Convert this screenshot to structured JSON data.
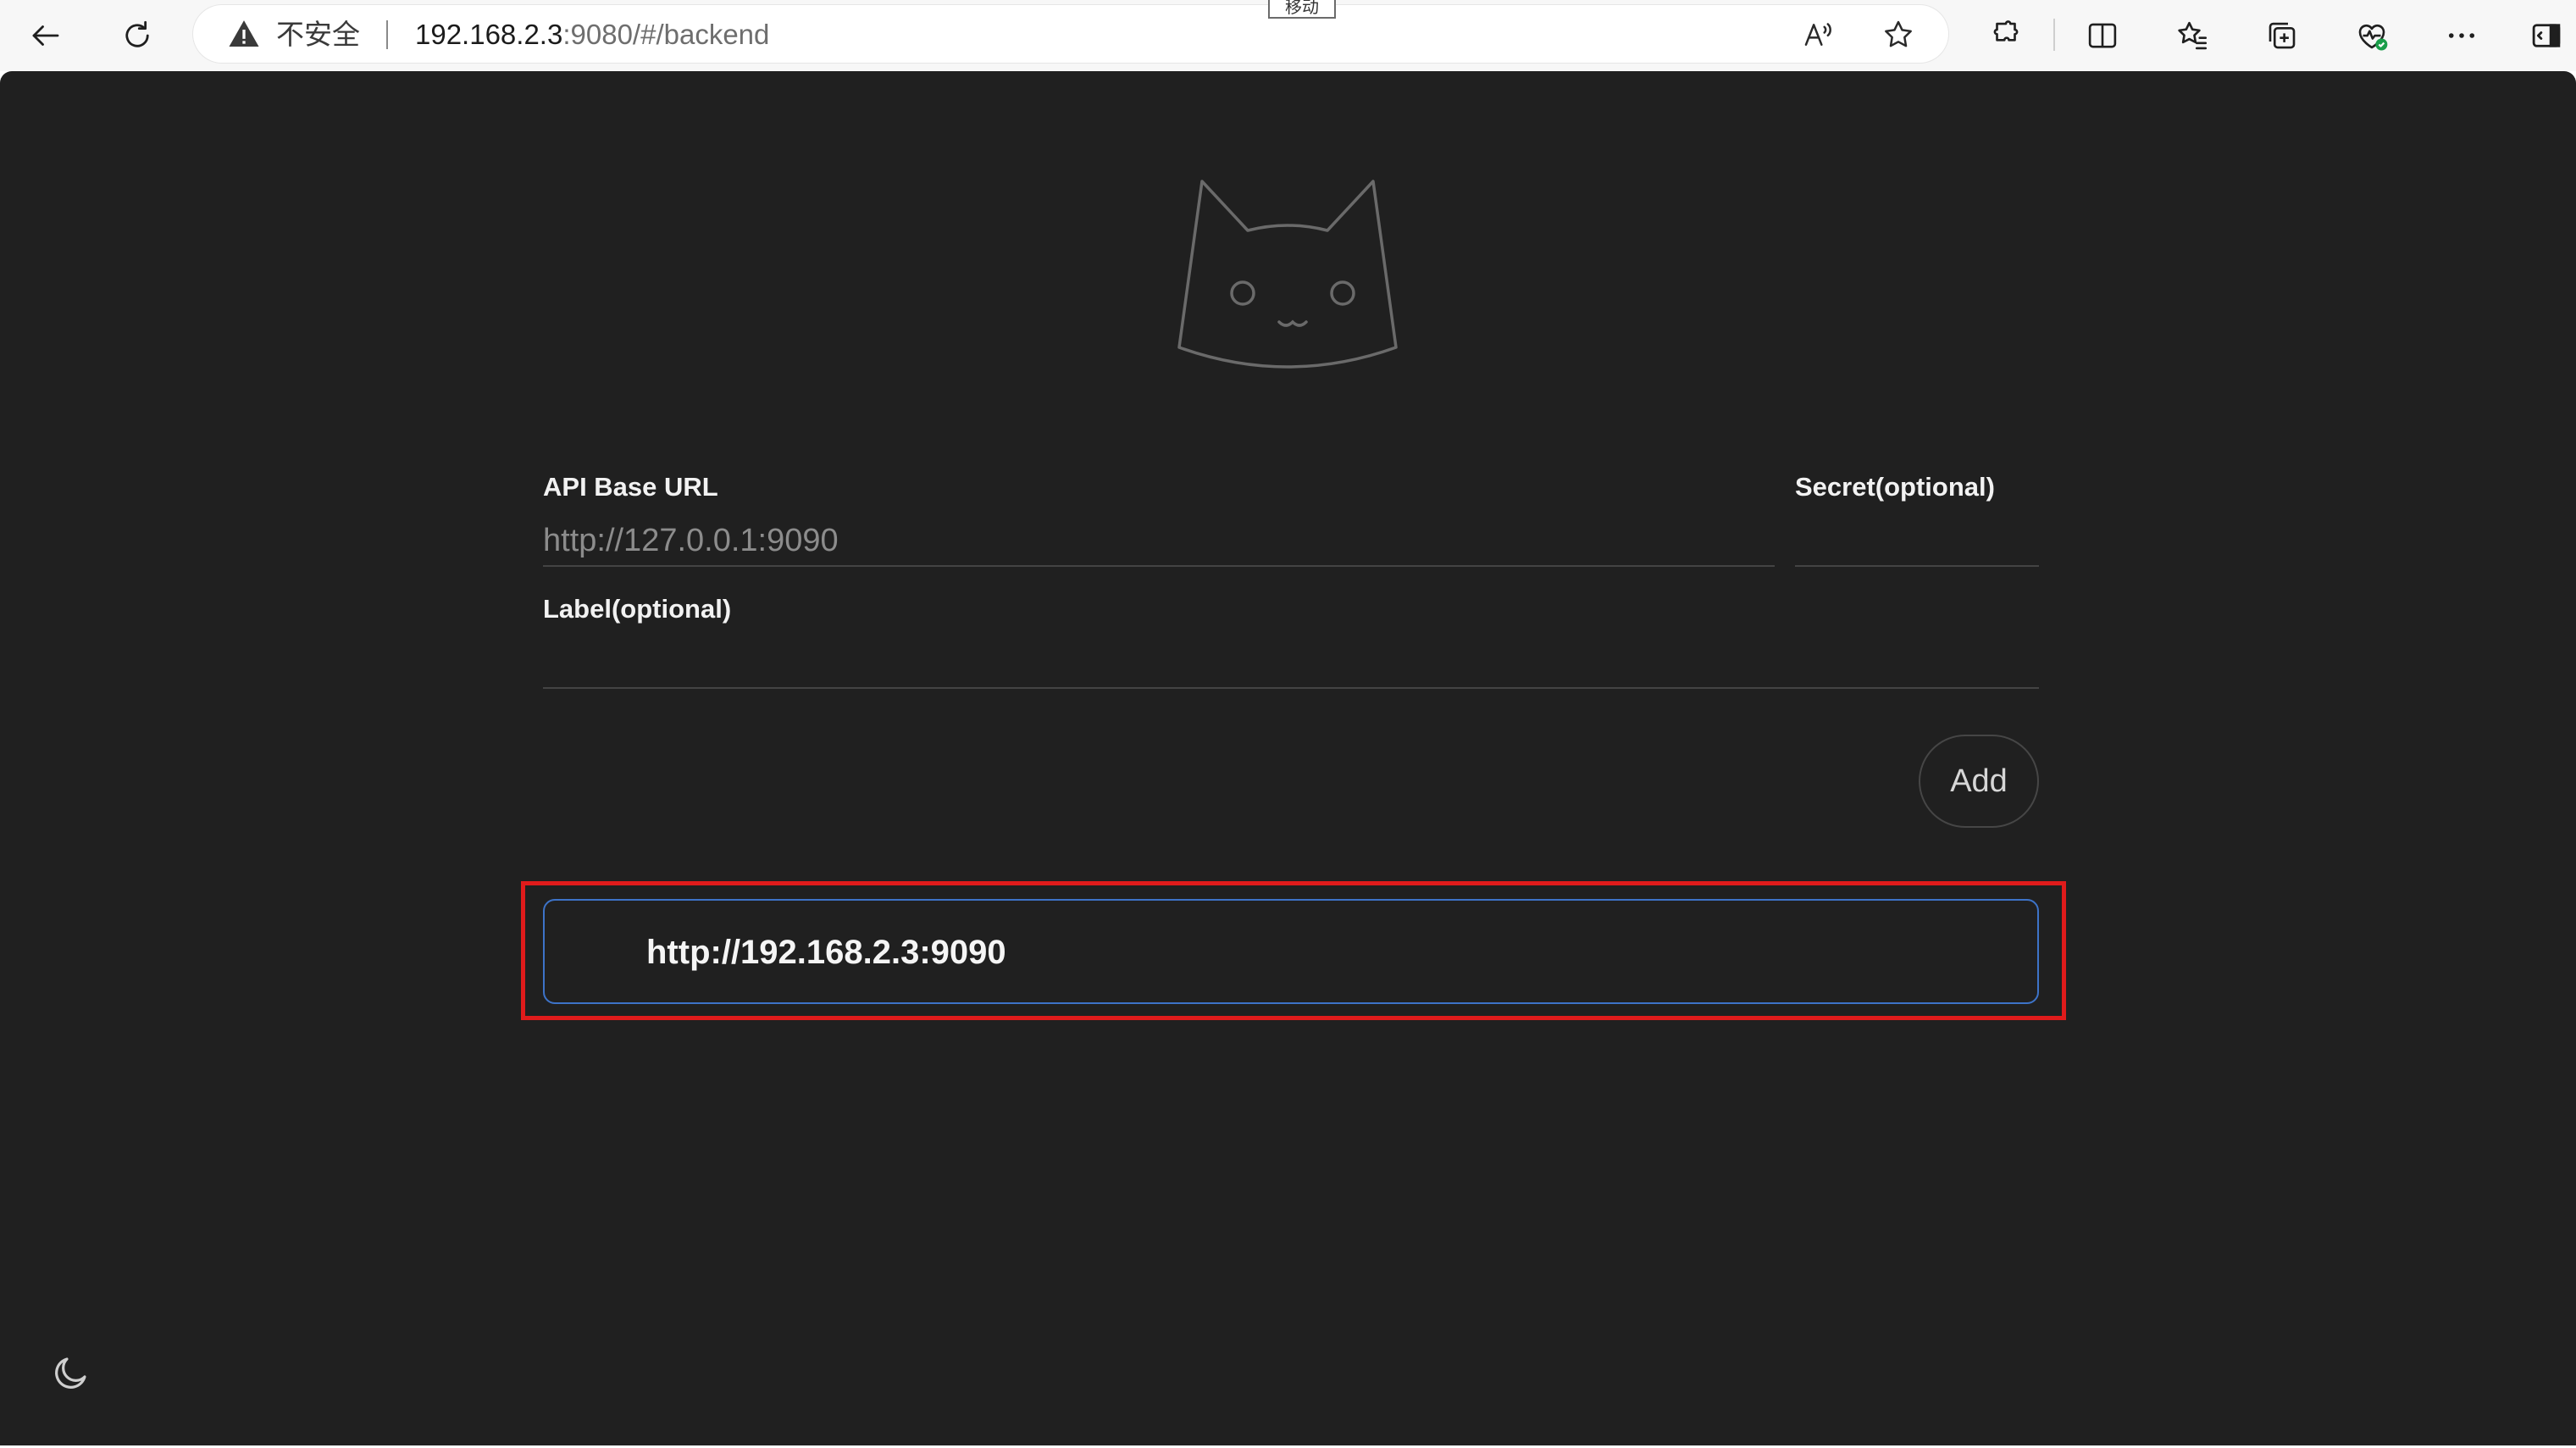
{
  "browser": {
    "tooltip": "移动",
    "security_label": "不安全",
    "url_host": "192.168.2.3",
    "url_rest": ":9080/#/backend",
    "icons": [
      "back-icon",
      "refresh-icon",
      "warning-icon",
      "read-aloud-icon",
      "favorite-star-icon",
      "extensions-icon",
      "split-screen-icon",
      "favorites-icon",
      "collections-icon",
      "browser-essentials-icon",
      "more-icon",
      "sidebar-icon"
    ]
  },
  "form": {
    "api_base_url_label": "API Base URL",
    "api_base_url_placeholder": "http://127.0.0.1:9090",
    "secret_label": "Secret(optional)",
    "label_label": "Label(optional)",
    "add_button": "Add"
  },
  "backends": [
    {
      "url": "http://192.168.2.3:9090",
      "selected": true
    }
  ],
  "colors": {
    "page_bg": "#202020",
    "highlight": "#e01b1b",
    "item_border": "#3d73c8"
  },
  "theme_toggle_icon": "moon-icon"
}
